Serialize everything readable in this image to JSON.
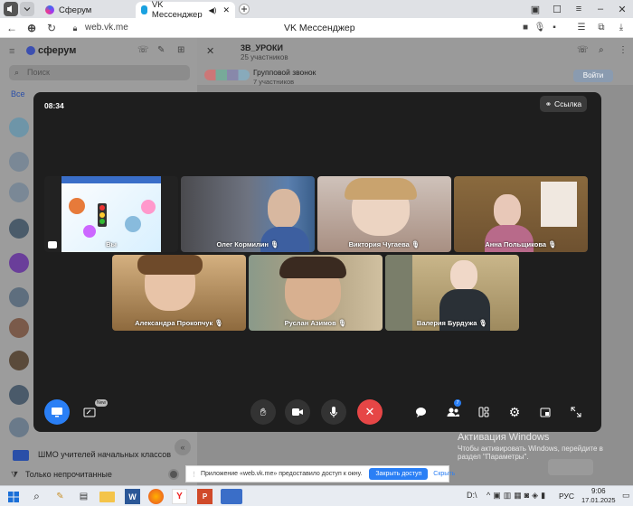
{
  "browser": {
    "tabs": [
      {
        "label": "Сферум"
      },
      {
        "label": "VK Мессенджер",
        "active": true
      }
    ],
    "address": "web.vk.me",
    "page_title": "VK Мессенджер"
  },
  "sidebar": {
    "logo_text": "сферум",
    "search_placeholder": "Поиск",
    "filter_all": "Все",
    "group_chat_name": "ШМО учителей начальных классов",
    "unread_only_label": "Только непрочитанные"
  },
  "chat": {
    "title": "3В_УРОКИ",
    "subtitle": "25 участников",
    "group_call_label": "Групповой звонок",
    "group_call_sub": "7 участников",
    "join_label": "Войти"
  },
  "call": {
    "time": "08:34",
    "link_label": "Ссылка",
    "participants": [
      {
        "name": "Вы",
        "mic": false
      },
      {
        "name": "Олег Кормилин",
        "mic": true
      },
      {
        "name": "Виктория Чугаева",
        "mic": true
      },
      {
        "name": "Анна Польщикова",
        "mic": true
      },
      {
        "name": "Александра Прокопчук",
        "mic": true
      },
      {
        "name": "Руслан Азимов",
        "mic": true
      },
      {
        "name": "Валерия Бурдужа",
        "mic": true
      }
    ],
    "participant_badge": "7",
    "screen_share_badge": "New"
  },
  "windows_activation": {
    "title": "Активация Windows",
    "line1": "Чтобы активировать Windows, перейдите в",
    "line2": "раздел \"Параметры\"."
  },
  "notification": {
    "text": "Приложение «web.vk.me» предоставило доступ к окну.",
    "stop_label": "Закрыть доступ",
    "hide_label": "Скрыть"
  },
  "taskbar": {
    "lang": "РУС",
    "time": "9:06",
    "date": "17.01.2025"
  },
  "colors": {
    "accent": "#2a7ff5",
    "end_call": "#e64646",
    "call_bg": "#1e1e1e"
  }
}
